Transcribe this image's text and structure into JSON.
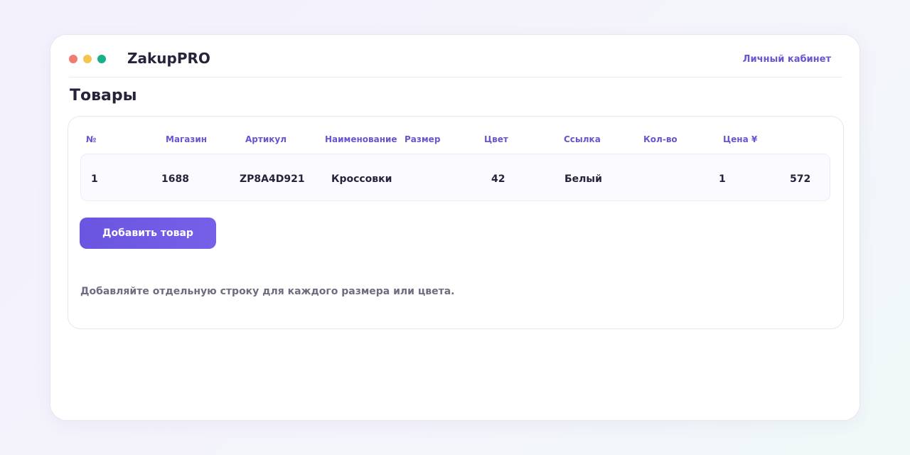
{
  "header": {
    "app_name": "ZakupPRO",
    "account_link": "Личный кабинет",
    "window_dots": [
      "red",
      "yellow",
      "green"
    ]
  },
  "page": {
    "title": "Товары"
  },
  "table": {
    "headers": {
      "num": "№",
      "store": "Магазин",
      "article": "Артикул",
      "name": "Наименование",
      "size": "Размер",
      "color": "Цвет",
      "link": "Ссылка",
      "qty": "Кол-во",
      "price": "Цена ¥"
    },
    "rows": [
      {
        "num": "1",
        "store": "1688",
        "article": "ZP8A4D921",
        "name": "Кроссовки",
        "size": "42",
        "color": "Белый",
        "link": "",
        "qty": "1",
        "price": "572"
      }
    ]
  },
  "actions": {
    "add_label": "Добавить товар"
  },
  "hint": "Добавляйте отдельную строку для каждого размера или цвета.",
  "colors": {
    "accent": "#6a54cf",
    "button": "#6a55e0",
    "dot_red": "#f07b6e",
    "dot_yellow": "#f5c451",
    "dot_green": "#16b08d",
    "text_dark": "#25243a",
    "text_muted": "#6e6d80"
  }
}
